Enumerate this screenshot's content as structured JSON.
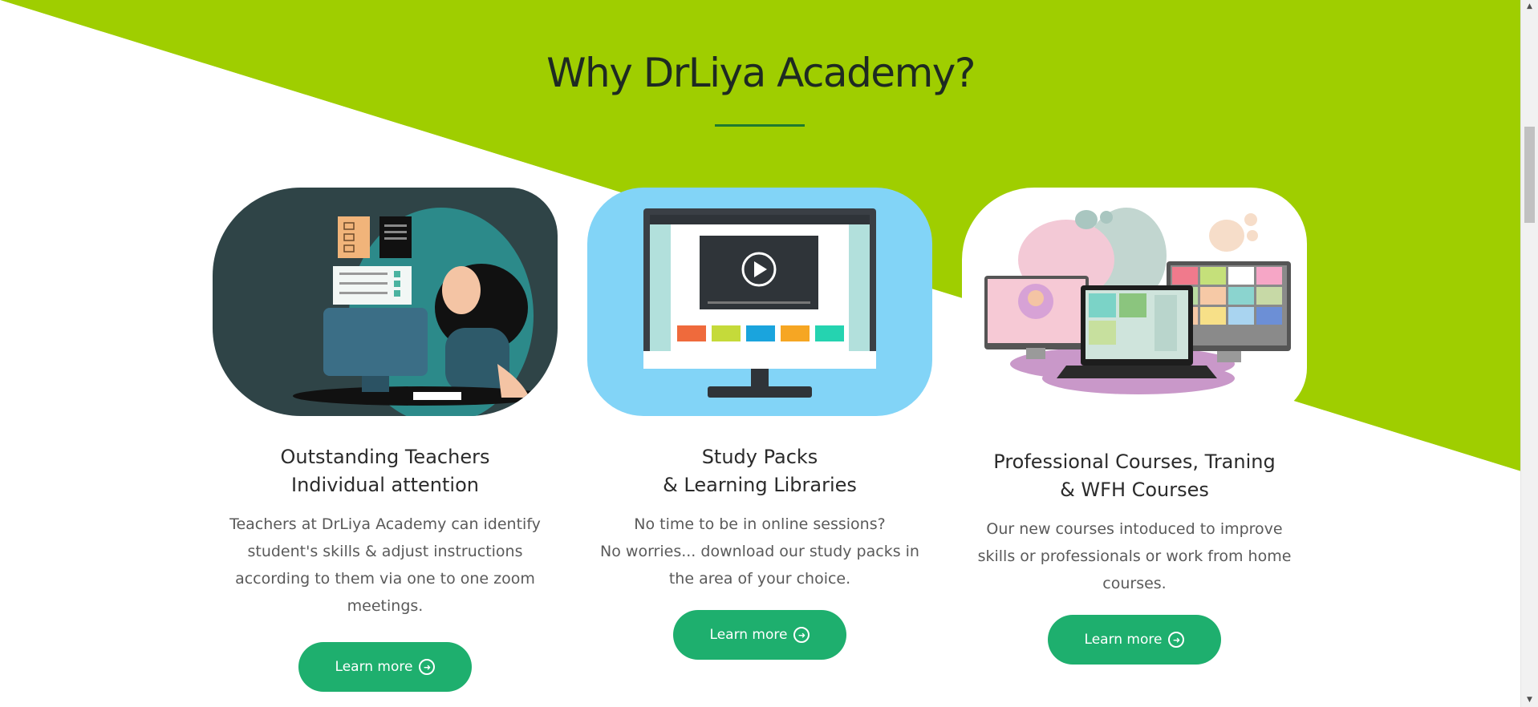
{
  "section": {
    "title": "Why DrLiya Academy?",
    "accent_color": "#9fce00",
    "underline_color": "#1e7a2e"
  },
  "cards": [
    {
      "title_lines": [
        "Outstanding Teachers",
        "Individual attention"
      ],
      "desc_lines": [
        "Teachers at DrLiya Academy can identify",
        "student's skills & adjust instructions",
        "according to them via one to one zoom",
        "meetings."
      ],
      "button_label": "Learn more",
      "illustration": "teacher-at-computer-illustration"
    },
    {
      "title_lines": [
        "Study Packs",
        "& Learning Libraries"
      ],
      "desc_lines": [
        "No time to be in online sessions?",
        "No worries... download our study packs in",
        "the area of your choice."
      ],
      "button_label": "Learn more",
      "illustration": "video-library-monitor-illustration"
    },
    {
      "title_lines": [
        "Professional Courses, Traning",
        "& WFH Courses"
      ],
      "desc_lines": [
        "Our new courses intoduced to improve",
        "skills or professionals or work from home",
        "courses."
      ],
      "button_label": "Learn more",
      "illustration": "video-conference-devices-illustration"
    }
  ],
  "button_icon": "arrow-circle-right-icon",
  "button_color": "#1eaf6e"
}
